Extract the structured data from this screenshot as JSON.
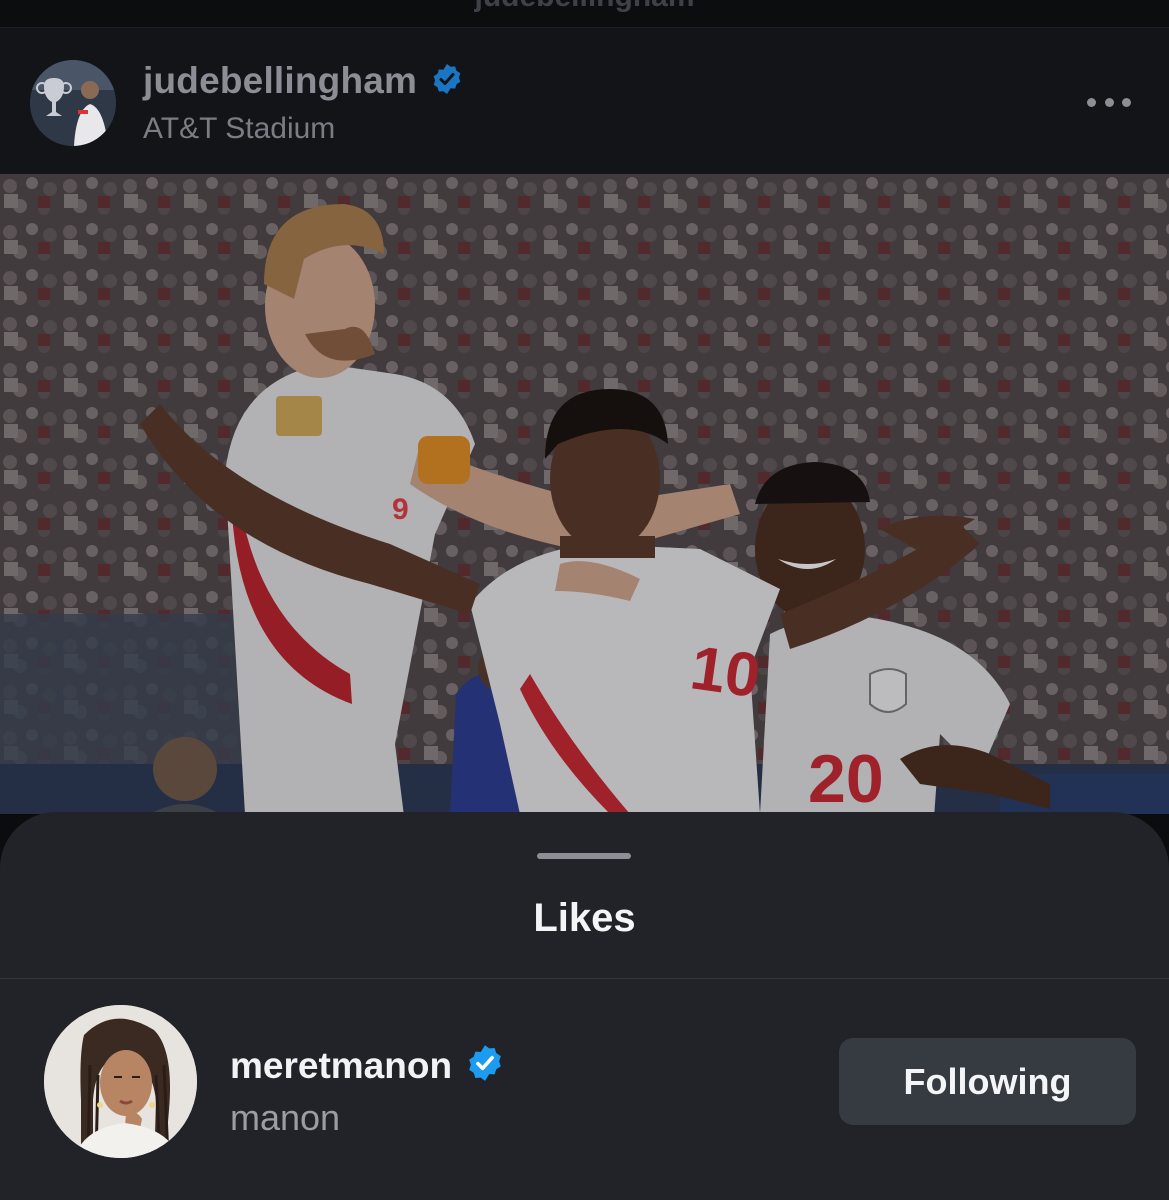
{
  "top_nav": {
    "title": "judebellingham"
  },
  "post": {
    "username": "judebellingham",
    "verified": true,
    "location": "AT&T Stadium",
    "more_icon": "more-horizontal-icon",
    "image": {
      "description_icon": "photo",
      "jersey_numbers": [
        "9",
        "10",
        "20"
      ]
    }
  },
  "likes_sheet": {
    "title": "Likes",
    "users": [
      {
        "username": "meretmanon",
        "verified": true,
        "full_name": "manon",
        "button_label": "Following"
      }
    ]
  },
  "colors": {
    "verified_blue": "#1d9bf0",
    "sheet_background": "#212328",
    "button_background": "#363a41",
    "jersey_red": "#c8102e"
  }
}
